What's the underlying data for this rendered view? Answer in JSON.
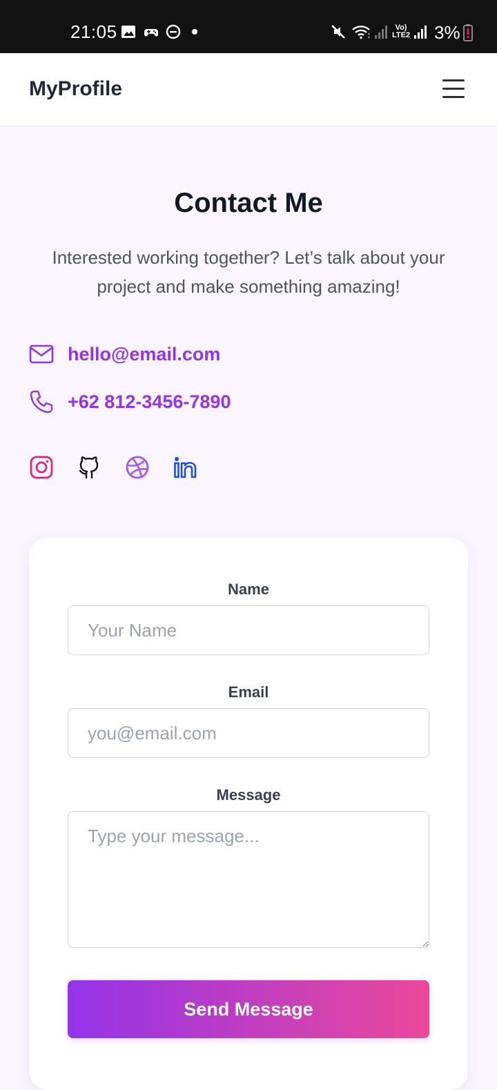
{
  "status_bar": {
    "time": "21:05",
    "battery": "3%",
    "network": "Vo) LTE2",
    "icons": [
      "image-icon",
      "game-controller-icon",
      "do-not-disturb-icon",
      "notification-dot-icon",
      "mute-icon",
      "wifi-icon",
      "signal-icon",
      "lte-icon",
      "signal-icon",
      "battery-low-icon"
    ]
  },
  "header": {
    "brand": "MyProfile",
    "menu_icon": "hamburger-menu-icon"
  },
  "contact": {
    "title": "Contact Me",
    "subtitle": "Interested working together? Let’s talk about your project and make something amazing!",
    "email": "hello@email.com",
    "phone": "+62 812-3456-7890",
    "email_icon": "mail-icon",
    "phone_icon": "phone-icon",
    "socials": [
      {
        "name": "instagram-icon",
        "color": "#db2777"
      },
      {
        "name": "github-icon",
        "color": "#111111"
      },
      {
        "name": "dribbble-icon",
        "color": "#a855f7"
      },
      {
        "name": "linkedin-icon",
        "color": "#1d4ed8"
      }
    ]
  },
  "form": {
    "name_label": "Name",
    "name_placeholder": "Your Name",
    "email_label": "Email",
    "email_placeholder": "you@email.com",
    "message_label": "Message",
    "message_placeholder": "Type your message...",
    "submit_label": "Send Message"
  },
  "colors": {
    "accent": "#9333ea",
    "accent_end": "#ec4899",
    "background": "#faf5fe"
  }
}
